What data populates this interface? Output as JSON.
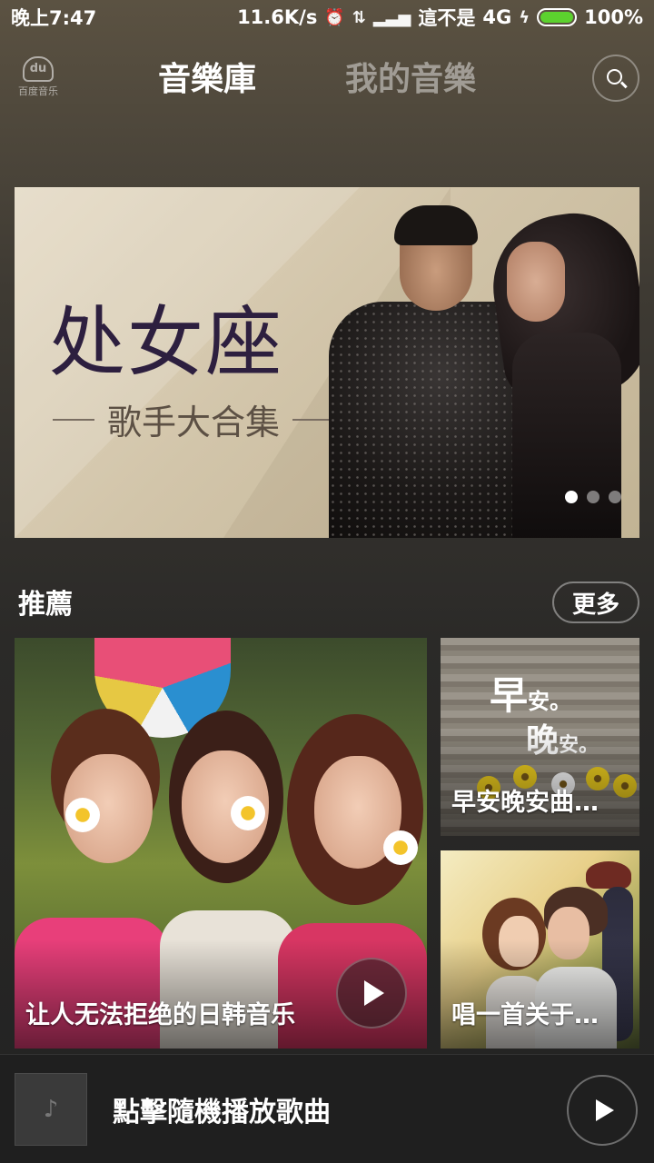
{
  "status_bar": {
    "time": "晚上7:47",
    "net_speed": "11.6K/s",
    "carrier": "這不是",
    "network": "4G",
    "battery": "100%"
  },
  "header": {
    "logo_mark": "du",
    "logo_text": "百度音乐",
    "tab_library": "音樂庫",
    "tab_mine": "我的音樂"
  },
  "banner": {
    "title": "处女座",
    "subtitle": "歌手大合集",
    "slide_count": 3,
    "active_slide": 1
  },
  "recommend": {
    "title": "推薦",
    "more": "更多",
    "cards": [
      {
        "label": "让人无法拒绝的日韩音乐"
      },
      {
        "label": "早安晚安曲…",
        "art_line1": "早",
        "art_line1_small": "安。",
        "art_line2": "晚",
        "art_line2_small": "安。"
      },
      {
        "label": "唱一首关于…"
      }
    ]
  },
  "player": {
    "prompt": "點擊隨機播放歌曲",
    "album_icon": "♪"
  },
  "colors": {
    "battery_green": "#5cd22e",
    "banner_title": "#2d1f3f"
  }
}
